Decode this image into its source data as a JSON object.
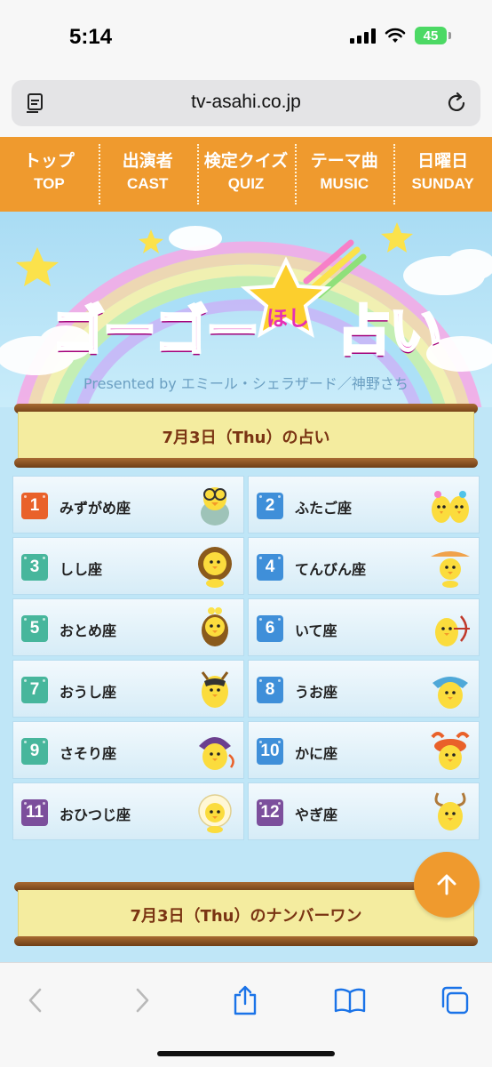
{
  "status_bar": {
    "time": "5:14",
    "battery": "45"
  },
  "browser": {
    "url": "tv-asahi.co.jp"
  },
  "nav": [
    {
      "jp": "トップ",
      "en": "TOP"
    },
    {
      "jp": "出演者",
      "en": "CAST"
    },
    {
      "jp": "検定クイズ",
      "en": "QUIZ"
    },
    {
      "jp": "テーマ曲",
      "en": "MUSIC"
    },
    {
      "jp": "日曜日",
      "en": "SUNDAY"
    }
  ],
  "hero": {
    "logo_left": "ゴーゴー",
    "logo_star": "ほし",
    "logo_right": "占い",
    "presented_by": "Presented by エミール・シェラザード／神野さち"
  },
  "ranking_banner": {
    "title": "7月3日（Thu）の占い"
  },
  "rankings": [
    {
      "rank": "1",
      "sign": "みずがめ座"
    },
    {
      "rank": "2",
      "sign": "ふたご座"
    },
    {
      "rank": "3",
      "sign": "しし座"
    },
    {
      "rank": "4",
      "sign": "てんびん座"
    },
    {
      "rank": "5",
      "sign": "おとめ座"
    },
    {
      "rank": "6",
      "sign": "いて座"
    },
    {
      "rank": "7",
      "sign": "おうし座"
    },
    {
      "rank": "8",
      "sign": "うお座"
    },
    {
      "rank": "9",
      "sign": "さそり座"
    },
    {
      "rank": "10",
      "sign": "かに座"
    },
    {
      "rank": "11",
      "sign": "おひつじ座"
    },
    {
      "rank": "12",
      "sign": "やぎ座"
    }
  ],
  "number_one_banner": {
    "title": "7月3日（Thu）のナンバーワン"
  },
  "colors": {
    "nav_orange": "#ef9a2e",
    "rank_first": "#e9612a",
    "rank_blue": "#3f8fd9",
    "rank_green": "#47b69c",
    "rank_purple": "#7c4f9c",
    "logo_pink": "#e62fb5"
  }
}
